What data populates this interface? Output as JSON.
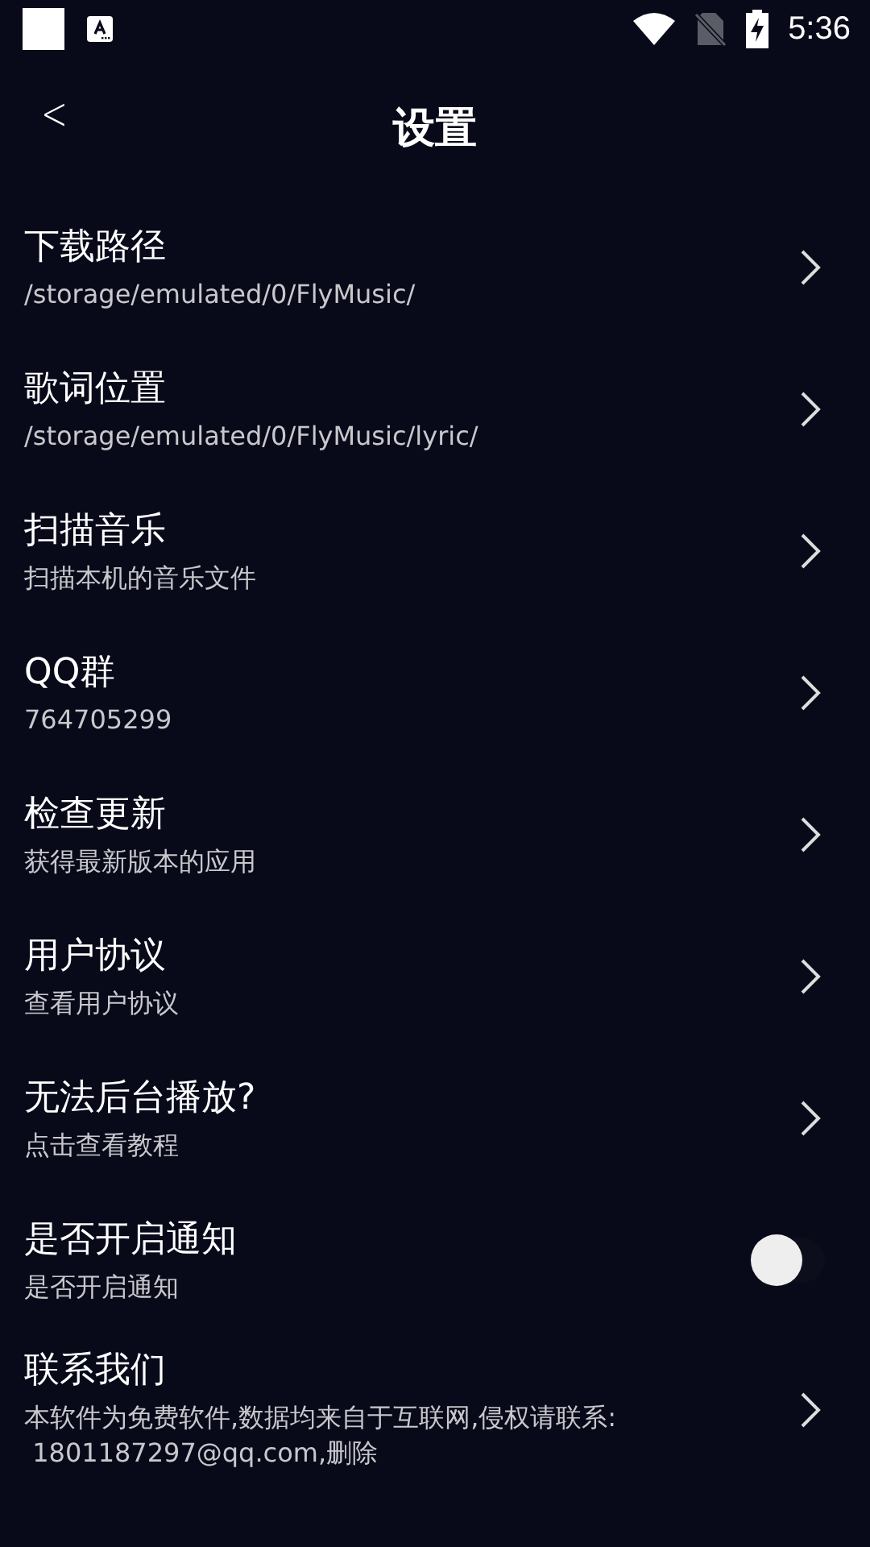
{
  "status_bar": {
    "time": "5:36"
  },
  "header": {
    "back": "<",
    "title": "设置"
  },
  "settings": [
    {
      "kind": "link",
      "title": "下载路径",
      "subtitle": "/storage/emulated/0/FlyMusic/"
    },
    {
      "kind": "link",
      "title": "歌词位置",
      "subtitle": "/storage/emulated/0/FlyMusic/lyric/"
    },
    {
      "kind": "link",
      "title": "扫描音乐",
      "subtitle": "扫描本机的音乐文件"
    },
    {
      "kind": "link",
      "title": "QQ群",
      "subtitle": "764705299"
    },
    {
      "kind": "link",
      "title": "检查更新",
      "subtitle": "获得最新版本的应用"
    },
    {
      "kind": "link",
      "title": "用户协议",
      "subtitle": "查看用户协议"
    },
    {
      "kind": "link",
      "title": "无法后台播放?",
      "subtitle": "点击查看教程"
    },
    {
      "kind": "toggle",
      "title": "是否开启通知",
      "subtitle": "是否开启通知",
      "on": false
    },
    {
      "kind": "link",
      "title": "联系我们",
      "subtitle": "本软件为免费软件,数据均来自于互联网,侵权请联系:\n 1801187297@qq.com,删除"
    }
  ]
}
